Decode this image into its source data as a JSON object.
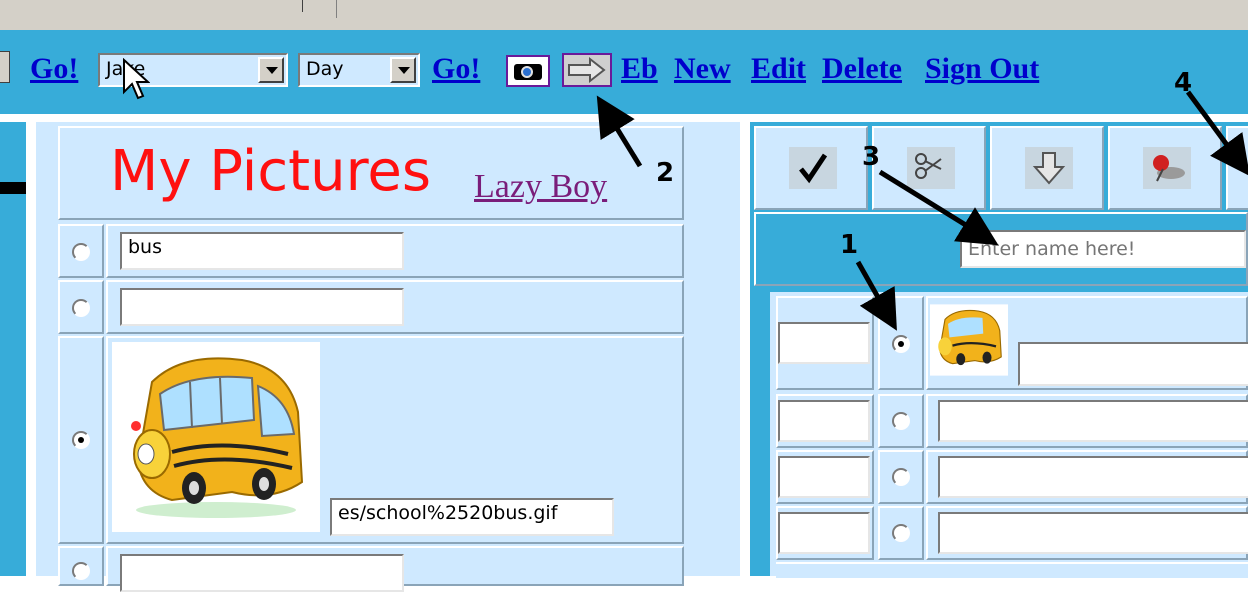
{
  "toolbar": {
    "go_label": "Go!",
    "user_select": "Jake",
    "period_select": "Day",
    "go2_label": "Go!",
    "links": [
      "Eb",
      "New",
      "Edit",
      "Delete",
      "Sign Out"
    ]
  },
  "left": {
    "title": "My Pictures",
    "subtitle_link": "Lazy Boy",
    "rows": [
      {
        "selected": false,
        "text": "bus"
      },
      {
        "selected": false,
        "text": ""
      },
      {
        "selected": true,
        "image": "school-bus-image",
        "filename": "es/school%2520bus.gif"
      },
      {
        "selected": false,
        "text": ""
      }
    ]
  },
  "right": {
    "buttons": [
      "check-icon",
      "scissors-icon",
      "down-arrow-icon",
      "pushpin-icon"
    ],
    "name_input_placeholder": "Enter name here!",
    "rows": [
      {
        "selected": true,
        "has_image": true
      },
      {
        "selected": false
      },
      {
        "selected": false
      },
      {
        "selected": false
      }
    ]
  },
  "callouts": [
    "1",
    "2",
    "3",
    "4"
  ]
}
